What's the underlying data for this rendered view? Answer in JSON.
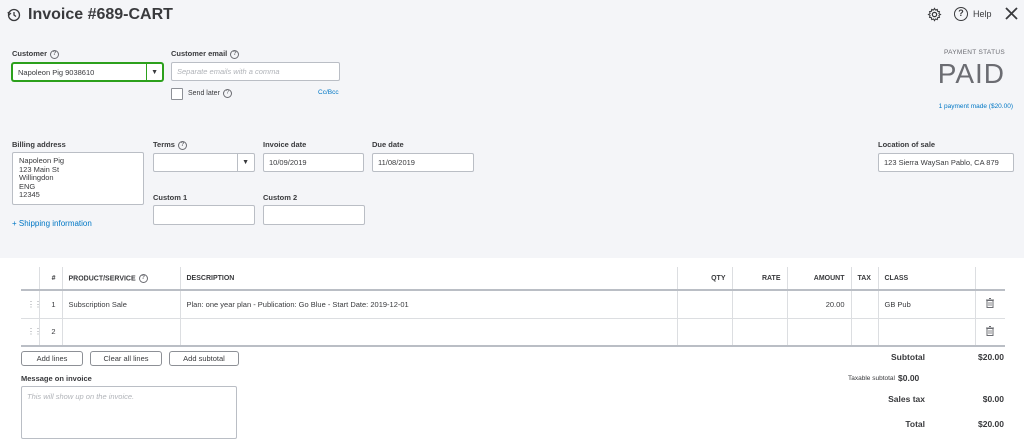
{
  "header": {
    "title": "Invoice #689-CART",
    "help_label": "Help"
  },
  "customer": {
    "label": "Customer",
    "value": "Napoleon Pig 9038610"
  },
  "email": {
    "label": "Customer email",
    "placeholder": "Separate emails with a comma",
    "send_later_label": "Send later",
    "cc_bcc_label": "Cc/Bcc"
  },
  "payment": {
    "status_label": "PAYMENT STATUS",
    "status_value": "PAID",
    "payments_link": "1 payment made ($20.00)"
  },
  "billing": {
    "label": "Billing address",
    "lines": [
      "Napoleon Pig",
      "123 Main St",
      "Willingdon",
      "ENG",
      "12345"
    ],
    "shipping_link": "+ Shipping information"
  },
  "terms": {
    "label": "Terms",
    "value": ""
  },
  "invoice_date": {
    "label": "Invoice date",
    "value": "10/09/2019"
  },
  "due_date": {
    "label": "Due date",
    "value": "11/08/2019"
  },
  "location": {
    "label": "Location of sale",
    "value": "123 Sierra WaySan Pablo, CA  879"
  },
  "custom1": {
    "label": "Custom 1",
    "value": ""
  },
  "custom2": {
    "label": "Custom 2",
    "value": ""
  },
  "table": {
    "headers": {
      "num": "#",
      "product": "PRODUCT/SERVICE",
      "description": "DESCRIPTION",
      "qty": "QTY",
      "rate": "RATE",
      "amount": "AMOUNT",
      "tax": "TAX",
      "class": "CLASS"
    },
    "rows": [
      {
        "num": "1",
        "product": "Subscription Sale",
        "description": "Plan: one year plan - Publication: Go Blue - Start Date: 2019-12-01",
        "qty": "",
        "rate": "",
        "amount": "20.00",
        "tax": "",
        "class": "GB Pub"
      },
      {
        "num": "2",
        "product": "",
        "description": "",
        "qty": "",
        "rate": "",
        "amount": "",
        "tax": "",
        "class": ""
      }
    ]
  },
  "buttons": {
    "add_lines": "Add lines",
    "clear_all_lines": "Clear all lines",
    "add_subtotal": "Add subtotal"
  },
  "message": {
    "label": "Message on invoice",
    "placeholder": "This will show up on the invoice."
  },
  "totals": {
    "subtotal_label": "Subtotal",
    "subtotal_value": "$20.00",
    "taxable_subtotal_label": "Taxable subtotal",
    "taxable_subtotal_value": "$0.00",
    "sales_tax_label": "Sales tax",
    "sales_tax_value": "$0.00",
    "total_label": "Total",
    "total_value": "$20.00"
  },
  "colors": {
    "accent": "#0077c5",
    "focus_green": "#2ca01c",
    "background": "#f4f5f8"
  }
}
